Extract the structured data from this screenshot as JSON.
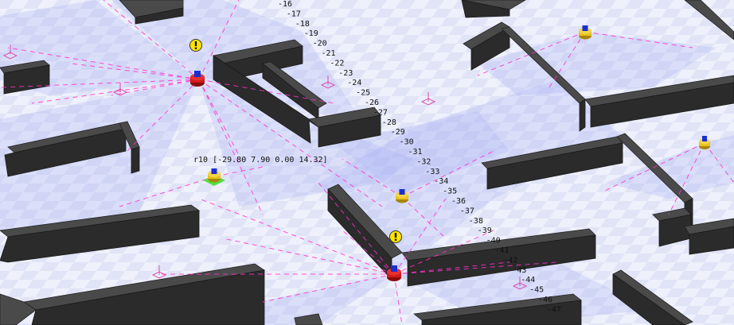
{
  "colors": {
    "floor": "#eef0fb",
    "checker": "#dfe3f7",
    "wall": "#3c3c3c",
    "wall_top": "#4a4a4a",
    "laser": "#ff33cc",
    "fov": "#a9b0f5",
    "robot_red": "#d11a1a",
    "robot_yellow": "#e8c21a",
    "robot_head": "#1a2fd1",
    "selection_green": "#44dd33",
    "alert_yellow": "#ffe400"
  },
  "ruler": {
    "labels": [
      "-16",
      "-17",
      "-18",
      "-19",
      "-20",
      "-21",
      "-22",
      "-23",
      "-24",
      "-25",
      "-26",
      "-27",
      "-28",
      "-29",
      "-30",
      "-31",
      "-32",
      "-33",
      "-34",
      "-35",
      "-36",
      "-37",
      "-38",
      "-39",
      "-40",
      "-41",
      "-42",
      "-43",
      "-44",
      "-45",
      "-46",
      "-47"
    ]
  },
  "robots": [
    {
      "id": "robot-red-1",
      "type": "red",
      "alert": true
    },
    {
      "id": "robot-red-2",
      "type": "red",
      "alert": true
    },
    {
      "id": "robot-yellow-selected",
      "type": "yellow",
      "selected": true
    },
    {
      "id": "robot-yellow-2",
      "type": "yellow"
    },
    {
      "id": "robot-yellow-3",
      "type": "yellow"
    },
    {
      "id": "robot-yellow-4",
      "type": "yellow"
    }
  ],
  "selected_robot": {
    "readout": "r10 [-29.80 7.90 0.00 14.32]"
  },
  "icons": {
    "alert": "exclamation-icon",
    "waypoint": "waypoint-marker-icon"
  }
}
